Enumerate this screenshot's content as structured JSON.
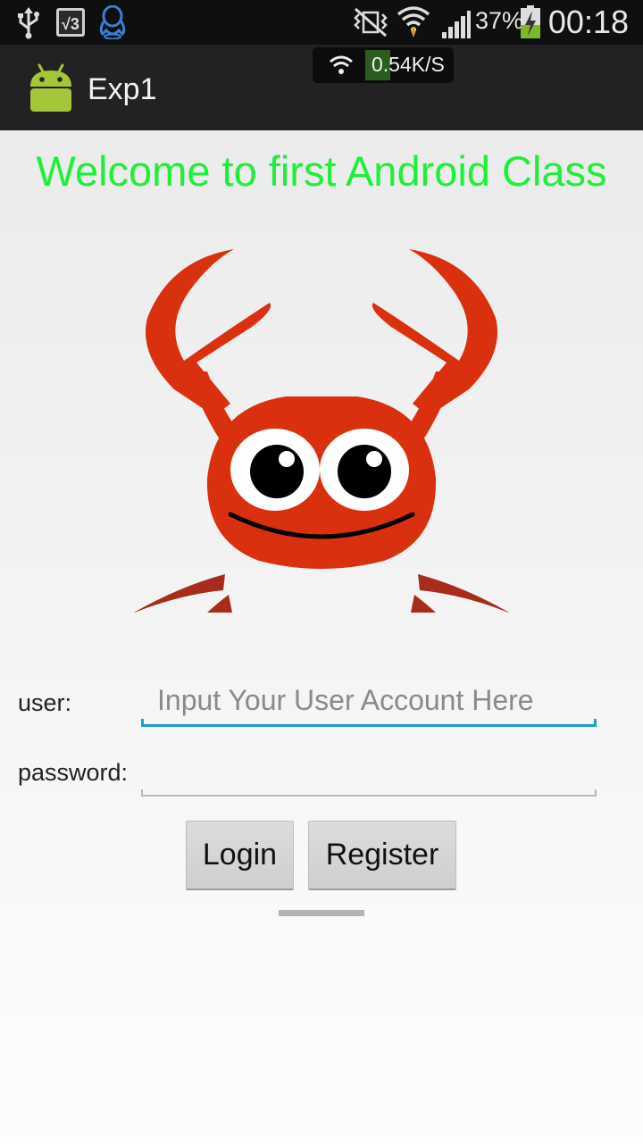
{
  "status_bar": {
    "battery_percent": "37%",
    "time": "00:18",
    "icons": [
      "usb-icon",
      "v3-app-icon",
      "qq-icon",
      "no-vibrate-icon",
      "wifi-icon",
      "signal-icon",
      "battery-charging-icon"
    ]
  },
  "network_speed": {
    "value": "0.54K/S",
    "icon": "wifi-icon"
  },
  "action_bar": {
    "title": "Exp1",
    "icon": "android-app-icon"
  },
  "main": {
    "welcome_text": "Welcome to first Android Class",
    "image": "crab-image",
    "form": {
      "user_label": "user:",
      "user_placeholder": "Input Your User Account Here",
      "user_value": "",
      "password_label": "password:",
      "password_value": "",
      "login_label": "Login",
      "register_label": "Register"
    }
  },
  "colors": {
    "welcome_text": "#1ef03a",
    "active_underline": "#1f9fd0",
    "crab": "#d9300f",
    "crab_legs": "#a82c1c"
  }
}
